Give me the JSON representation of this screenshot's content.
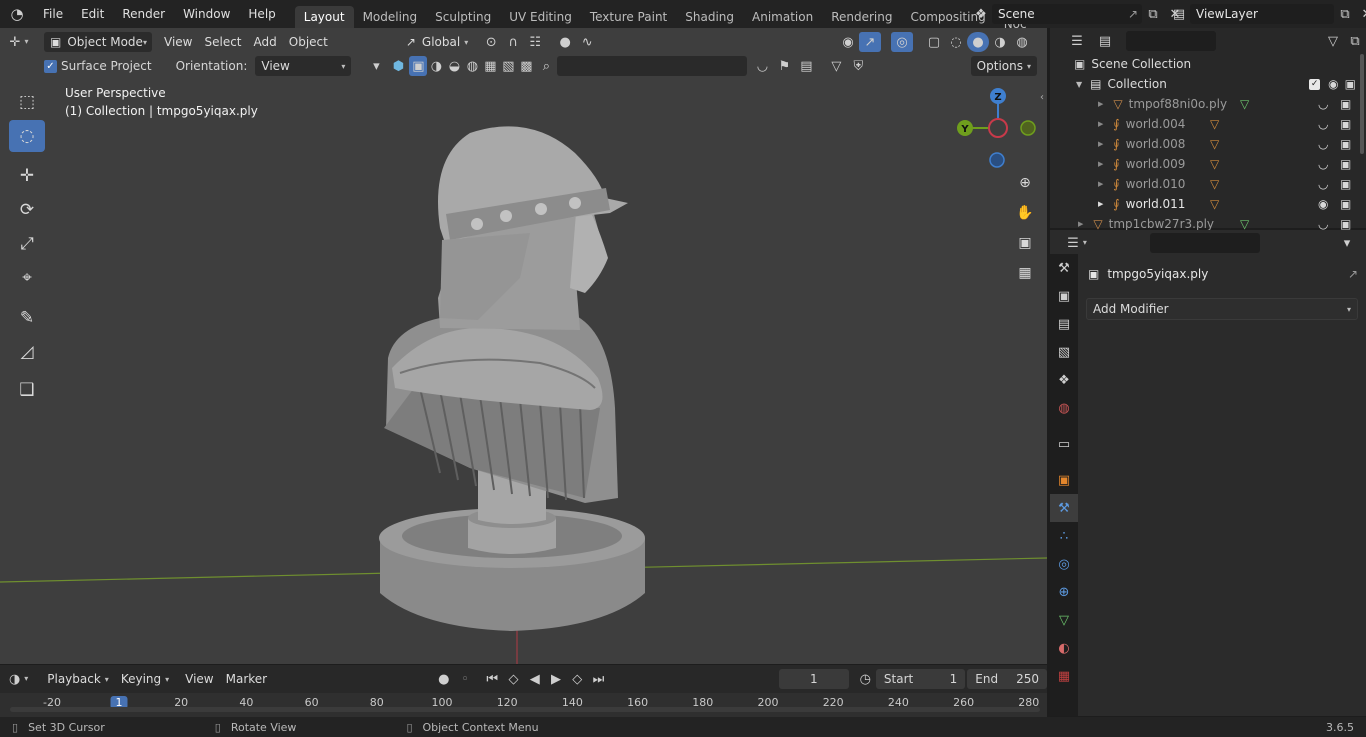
{
  "topbar": {
    "menus": [
      "File",
      "Edit",
      "Render",
      "Window",
      "Help"
    ],
    "workspaces": [
      "Layout",
      "Modeling",
      "Sculpting",
      "UV Editing",
      "Texture Paint",
      "Shading",
      "Animation",
      "Rendering",
      "Compositing",
      "Geometry Noc"
    ],
    "scene": "Scene",
    "view_layer": "ViewLayer"
  },
  "viewport": {
    "mode": "Object Mode",
    "menus": [
      "View",
      "Select",
      "Add",
      "Object"
    ],
    "transform_orientation": "Global",
    "surface_project_label": "Surface Project",
    "orientation_label": "Orientation:",
    "orientation_value": "View",
    "options_label": "Options",
    "perspective_text": "User Perspective",
    "collection_text": "(1) Collection | tmpgo5yiqax.ply",
    "gizmo": {
      "z": "Z",
      "y": "Y"
    }
  },
  "outliner": {
    "root": "Scene Collection",
    "collection": "Collection",
    "items": [
      {
        "name": "tmpof88ni0o.ply",
        "bright": false
      },
      {
        "name": "world.004",
        "bright": false
      },
      {
        "name": "world.008",
        "bright": false
      },
      {
        "name": "world.009",
        "bright": false
      },
      {
        "name": "world.010",
        "bright": false
      },
      {
        "name": "world.011",
        "bright": true
      },
      {
        "name": "tmp1cbw27r3.ply",
        "bright": false
      }
    ]
  },
  "properties": {
    "object_name": "tmpgo5yiqax.ply",
    "add_modifier": "Add Modifier"
  },
  "timeline": {
    "menus": [
      "Playback",
      "Keying",
      "View",
      "Marker"
    ],
    "current_frame": "1",
    "start_label": "Start",
    "start": "1",
    "end_label": "End",
    "end": "250",
    "ruler": [
      "-20",
      "1",
      "20",
      "40",
      "60",
      "80",
      "100",
      "120",
      "140",
      "160",
      "180",
      "200",
      "220",
      "240",
      "260",
      "280"
    ]
  },
  "statusbar": {
    "left": "Set 3D Cursor",
    "middle": "Rotate View",
    "right": "Object Context Menu",
    "version": "3.6.5"
  },
  "colors": {
    "accent": "#4772b3",
    "x_axis": "#c83a4a",
    "y_axis": "#6f9e1d",
    "z_axis": "#3f7fcf"
  }
}
